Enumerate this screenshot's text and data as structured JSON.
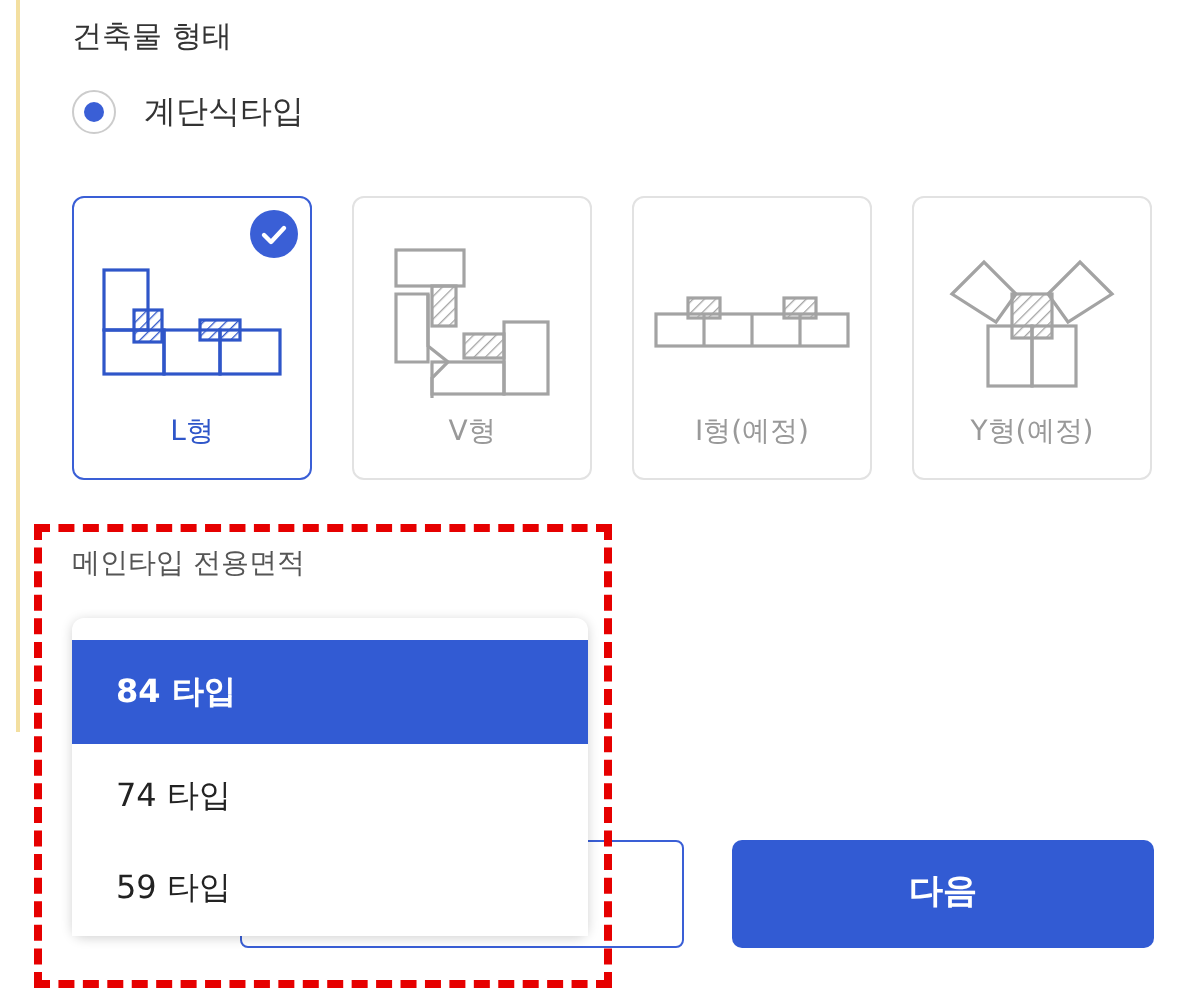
{
  "building_form": {
    "title": "건축물 형태",
    "radio": {
      "label": "계단식타입",
      "selected": true
    }
  },
  "types": [
    {
      "kind": "L",
      "label": "L형",
      "selected": true
    },
    {
      "kind": "V",
      "label": "V형",
      "selected": false
    },
    {
      "kind": "I",
      "label": "I형(예정)",
      "selected": false
    },
    {
      "kind": "Y",
      "label": "Y형(예정)",
      "selected": false
    }
  ],
  "area": {
    "title": "메인타입 전용면적",
    "highlighted": true,
    "options": [
      {
        "label": "84 타입",
        "selected": true
      },
      {
        "label": "74 타입",
        "selected": false
      },
      {
        "label": "59 타입",
        "selected": false
      }
    ]
  },
  "buttons": [
    {
      "kind": "outline"
    },
    {
      "kind": "primary",
      "label": "다음"
    }
  ]
}
